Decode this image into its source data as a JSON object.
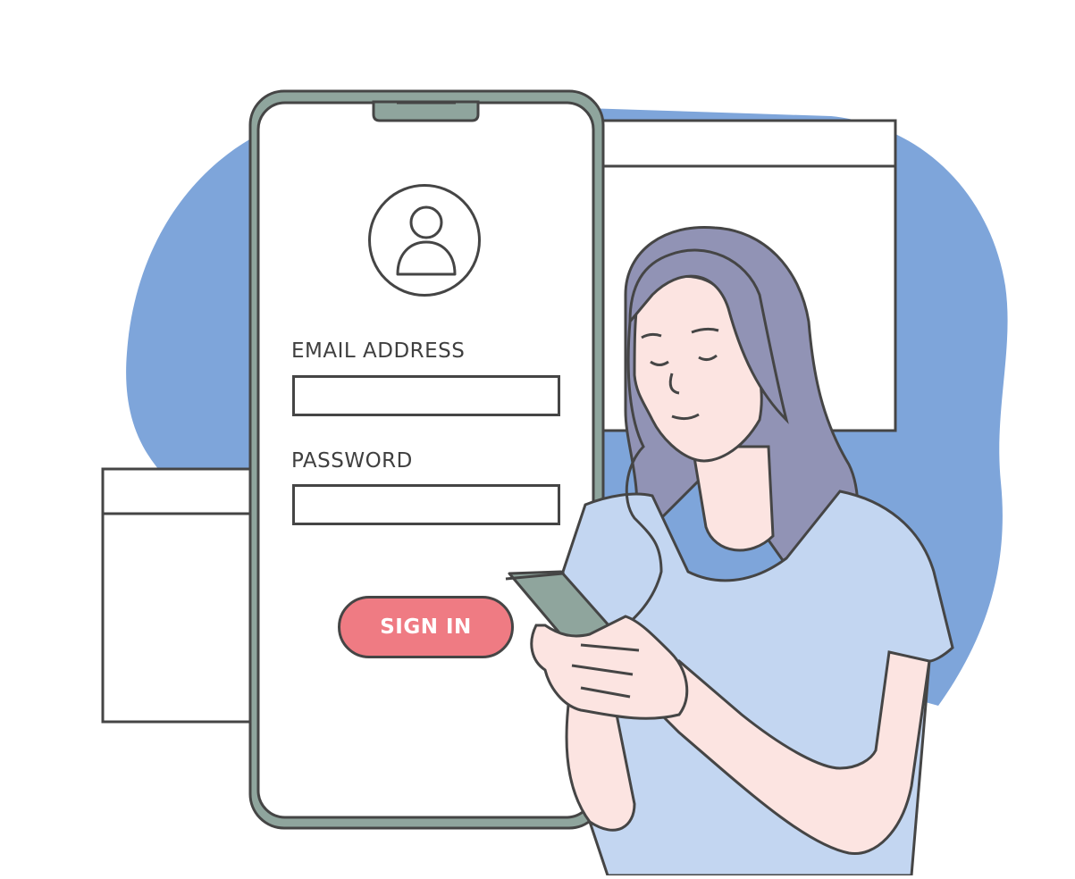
{
  "login_form": {
    "email_label": "EMAIL ADDRESS",
    "email_value": "",
    "password_label": "PASSWORD",
    "password_value": "",
    "signin_label": "SIGN IN"
  },
  "colors": {
    "backdrop_blob": "#7ea5da",
    "phone_frame": "#8fa59d",
    "signin_button": "#ef7b83",
    "hair": "#9193b5",
    "skin": "#fce4e1",
    "shirt": "#c3d6f1",
    "outline": "#454545"
  },
  "icons": [
    "user-avatar-icon",
    "phone-notch-icon",
    "handheld-phone-icon"
  ]
}
